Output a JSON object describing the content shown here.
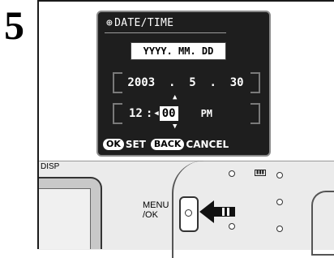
{
  "step": {
    "number": "5"
  },
  "lcd": {
    "title": "DATE/TIME",
    "title_icon": "clock-icon",
    "format": "YYYY. MM. DD",
    "date": {
      "year": "2003",
      "sep1": ".",
      "month": "5",
      "sep2": ".",
      "day": "30"
    },
    "time": {
      "hour": "12",
      "separator": ":",
      "minute": "00",
      "ampm": "PM"
    },
    "buttons": {
      "ok_pill": "OK",
      "ok_label": "SET",
      "back_pill": "BACK",
      "back_label": "CANCEL"
    }
  },
  "camera": {
    "disp_label": "DISP",
    "menu_label_line1": "MENU",
    "menu_label_line2": "/OK",
    "battery_icon": "battery-icon"
  }
}
